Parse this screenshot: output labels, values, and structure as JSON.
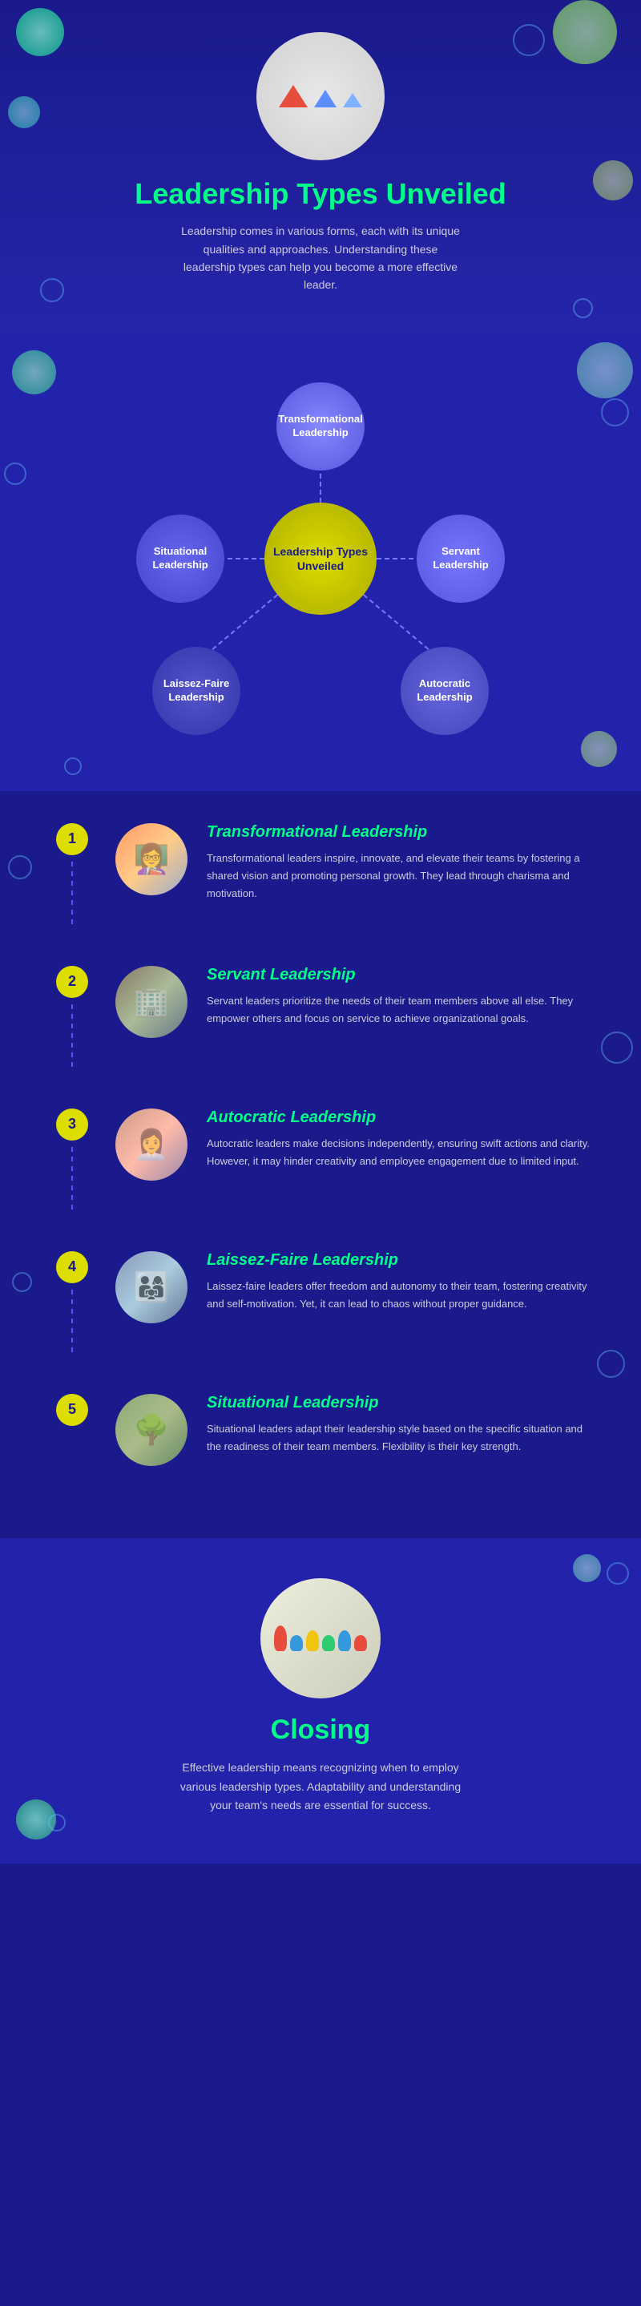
{
  "hero": {
    "title": "Leadership Types Unveiled",
    "description": "Leadership comes in various forms, each with its unique qualities and approaches. Understanding these leadership types can help you become a more effective leader."
  },
  "mindmap": {
    "center": "Leadership Types Unveiled",
    "nodes": {
      "top": "Transformational Leadership",
      "left": "Situational Leadership",
      "right": "Servant Leadership",
      "bottom_left": "Laissez-Faire Leadership",
      "bottom_right": "Autocratic Leadership"
    }
  },
  "items": [
    {
      "number": "1",
      "title": "Transformational Leadership",
      "description": "Transformational leaders inspire, innovate, and elevate their teams by fostering a shared vision and promoting personal growth. They lead through charisma and motivation."
    },
    {
      "number": "2",
      "title": "Servant Leadership",
      "description": "Servant leaders prioritize the needs of their team members above all else. They empower others and focus on service to achieve organizational goals."
    },
    {
      "number": "3",
      "title": "Autocratic Leadership",
      "description": "Autocratic leaders make decisions independently, ensuring swift actions and clarity. However, it may hinder creativity and employee engagement due to limited input."
    },
    {
      "number": "4",
      "title": "Laissez-Faire Leadership",
      "description": "Laissez-faire leaders offer freedom and autonomy to their team, fostering creativity and self-motivation. Yet, it can lead to chaos without proper guidance."
    },
    {
      "number": "5",
      "title": "Situational Leadership",
      "description": "Situational leaders adapt their leadership style based on the specific situation and the readiness of their team members. Flexibility is their key strength."
    }
  ],
  "closing": {
    "title": "Closing",
    "description": "Effective leadership means recognizing when to employ various leadership types. Adaptability and understanding your team's needs are essential for success."
  }
}
